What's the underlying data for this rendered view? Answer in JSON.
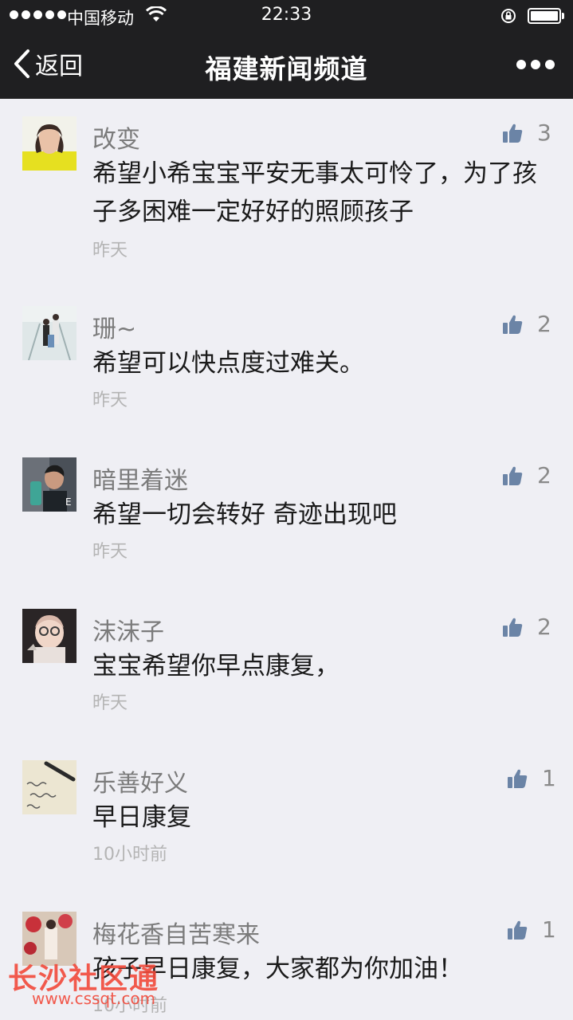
{
  "status_bar": {
    "carrier": "中国移动",
    "time": "22:33",
    "icons": [
      "signal-dots",
      "wifi-icon",
      "rotation-lock-icon",
      "battery-icon"
    ]
  },
  "nav": {
    "back_label": "返回",
    "title": "福建新闻频道",
    "more_icon": "more-dots-icon"
  },
  "comments": [
    {
      "name": "改变",
      "text": "希望小希宝宝平安无事太可怜了，为了孩子多困难一定好好的照顾孩子",
      "time": "昨天",
      "likes": "3"
    },
    {
      "name": "珊~",
      "text": "希望可以快点度过难关。",
      "time": "昨天",
      "likes": "2"
    },
    {
      "name": "暗里着迷",
      "text": "希望一切会转好 奇迹出现吧",
      "time": "昨天",
      "likes": "2"
    },
    {
      "name": "沫沫子",
      "text": "宝宝希望你早点康复，",
      "time": "昨天",
      "likes": "2"
    },
    {
      "name": "乐善好义",
      "text": "早日康复",
      "time": "10小时前",
      "likes": "1"
    },
    {
      "name": "梅花香自苦寒来",
      "text": "孩子早日康复，大家都为你加油！",
      "time": "10小时前",
      "likes": "1"
    }
  ],
  "watermark": {
    "logo": "长沙社区通",
    "url": "www.cssqt.com"
  },
  "colors": {
    "topbar": "#1f1f21",
    "background": "#efeff4",
    "like_icon": "#6b84a6",
    "watermark": "#f2493a"
  }
}
